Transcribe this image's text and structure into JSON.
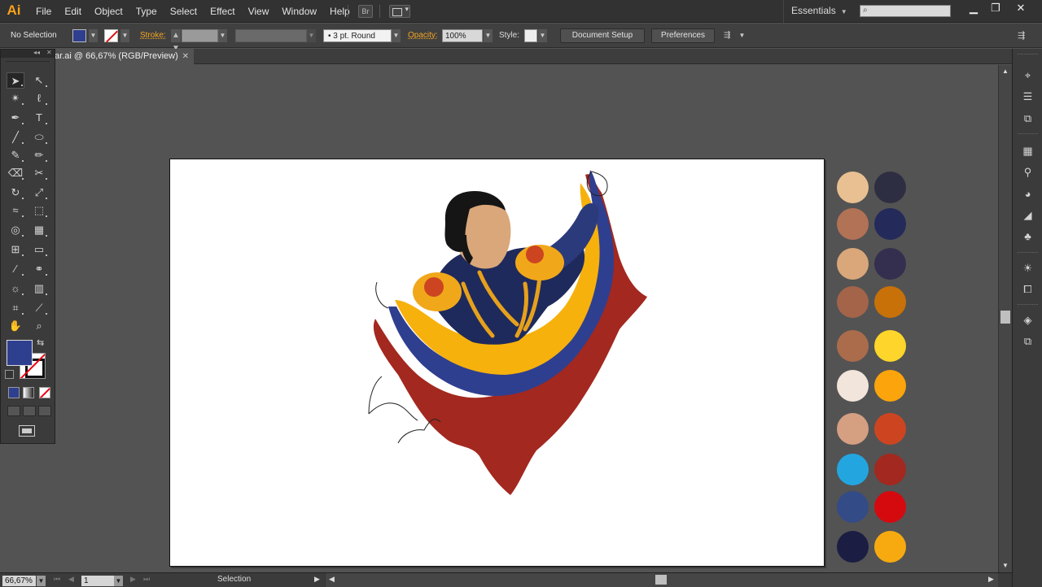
{
  "app": {
    "logo": "Ai"
  },
  "menubar": {
    "menus": [
      "File",
      "Edit",
      "Object",
      "Type",
      "Select",
      "Effect",
      "View",
      "Window",
      "Help"
    ],
    "bridge_label": "Br",
    "workspace": "Essentials",
    "search_placeholder": ""
  },
  "controlbar": {
    "selection": "No Selection",
    "stroke_label": "Stroke:",
    "brush": "3 pt. Round",
    "opacity_label": "Opacity:",
    "opacity": "100%",
    "style_label": "Style:",
    "document_setup": "Document Setup",
    "preferences": "Preferences"
  },
  "document": {
    "tab_title": "ar.ai @ 66,67% (RGB/Preview)",
    "fill_color": "#2f3f8f"
  },
  "statusbar": {
    "zoom": "66,67%",
    "page": "1",
    "current_tool": "Selection"
  },
  "palette": {
    "left": [
      "#e9c092",
      "#b27256",
      "#d9a77a",
      "#a3644a",
      "#ab6c4c",
      "#f2e5dc",
      "#d59f82",
      "#23a6e0",
      "#334b87",
      "#1c1d43"
    ],
    "right": [
      "#2e2e42",
      "#242a5a",
      "#342f4e",
      "#c87108",
      "#fed52a",
      "#fba40c",
      "#cd4520",
      "#a3281f",
      "#d50a0f",
      "#f7aa10"
    ]
  },
  "artwork": {
    "flag_yellow": "#f6b10d",
    "flag_blue": "#2f3f8f",
    "flag_red": "#a3281f",
    "uniform": "#1f2a5c",
    "skin": "#d9a77a",
    "hair": "#151515",
    "epaulette": "#f0a81a"
  }
}
